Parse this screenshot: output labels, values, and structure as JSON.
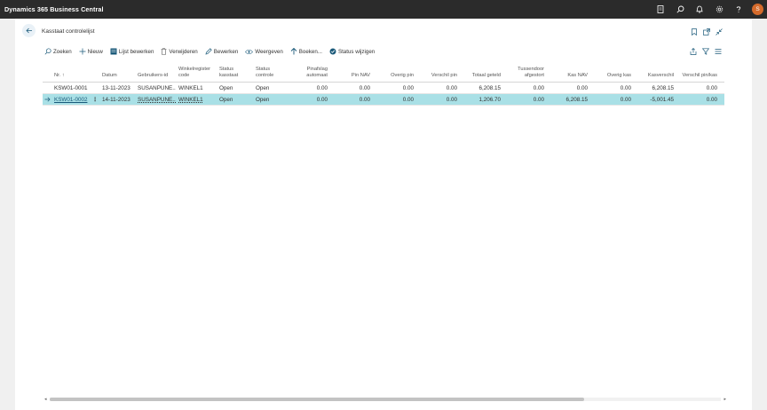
{
  "app": {
    "title": "Dynamics 365 Business Central",
    "avatar_initial": "S"
  },
  "page": {
    "title": "Kasstaat controlelijst"
  },
  "toolbar": {
    "search": "Zoeken",
    "new": "Nieuw",
    "edit_list": "Lijst bewerken",
    "delete": "Verwijderen",
    "edit": "Bewerken",
    "view": "Weergeven",
    "post": "Boeken...",
    "change_status": "Status wijzigen"
  },
  "table": {
    "headers": {
      "nr": "Nr. ↑",
      "datum": "Datum",
      "gebruikers_id": "Gebruikers-id",
      "winkelregister_1": "Winkelregister",
      "winkelregister_2": "code",
      "status_kasstaat_1": "Status",
      "status_kasstaat_2": "kasstaat",
      "status_controle_1": "Status",
      "status_controle_2": "controle",
      "pinafslag_1": "Pinafslag",
      "pinafslag_2": "automaat",
      "pin_nav": "Pin NAV",
      "overig_pin": "Overig pin",
      "verschil_pin": "Verschil pin",
      "totaal_geteld": "Totaal geteld",
      "tussendoor_1": "Tussendoor",
      "tussendoor_2": "afgestort",
      "kas_nav": "Kas NAV",
      "overig_kas": "Overig kas",
      "kasverschil": "Kasverschil",
      "verschil_pin_kas": "Verschil pin/kas"
    },
    "rows": [
      {
        "nr": "KSW01-0001",
        "datum": "13-11-2023",
        "gebruiker": "SUSANPUNE...",
        "winkel": "WINKEL1",
        "status_kasstaat": "Open",
        "status_controle": "Open",
        "pinafslag": "0.00",
        "pin_nav": "0.00",
        "overig_pin": "0.00",
        "verschil_pin": "0.00",
        "totaal_geteld": "6,208.15",
        "tussendoor": "0.00",
        "kas_nav": "0.00",
        "overig_kas": "0.00",
        "kasverschil": "6,208.15",
        "verschil_pin_kas": "0.00"
      },
      {
        "nr": "KSW01-0002",
        "datum": "14-11-2023",
        "gebruiker": "SUSANPUNE...",
        "winkel": "WINKEL1",
        "status_kasstaat": "Open",
        "status_controle": "Open",
        "pinafslag": "0.00",
        "pin_nav": "0.00",
        "overig_pin": "0.00",
        "verschil_pin": "0.00",
        "totaal_geteld": "1,206.70",
        "tussendoor": "0.00",
        "kas_nav": "6,208.15",
        "overig_kas": "0.00",
        "kasverschil": "-5,001.45",
        "verschil_pin_kas": "0.00"
      }
    ]
  },
  "colors": {
    "topbar": "#2b2b2b",
    "selected_row": "#a9e0e6",
    "accent": "#1b5a7a",
    "avatar": "#d56b2c"
  }
}
